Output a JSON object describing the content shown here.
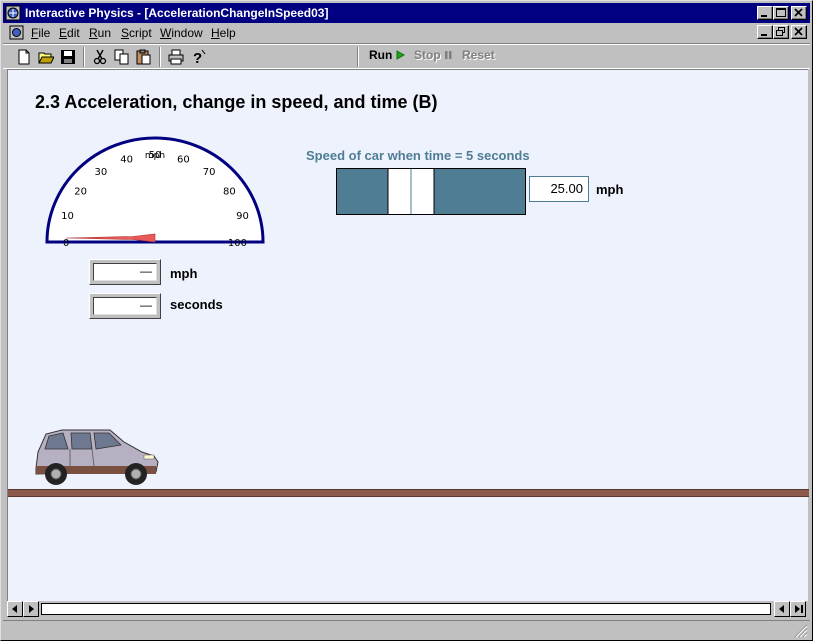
{
  "window": {
    "title": "Interactive Physics - [AccelerationChangeInSpeed03]"
  },
  "menu": {
    "items": [
      {
        "label": "File",
        "key": "F",
        "rest": "ile"
      },
      {
        "label": "Edit",
        "key": "E",
        "rest": "dit"
      },
      {
        "label": "Run",
        "key": "R",
        "rest": "un"
      },
      {
        "label": "Script",
        "key": "S",
        "rest": "cript"
      },
      {
        "label": "Window",
        "key": "W",
        "rest": "indow"
      },
      {
        "label": "Help",
        "key": "H",
        "rest": "elp"
      }
    ]
  },
  "toolbar": {
    "buttons": [
      "new-icon",
      "open-icon",
      "save-icon",
      "cut-icon",
      "copy-icon",
      "paste-icon",
      "print-icon",
      "help-icon"
    ],
    "run_label": "Run",
    "stop_label": "Stop",
    "reset_label": "Reset"
  },
  "doc": {
    "title": "2.3 Acceleration, change in speed, and time (B)",
    "speedometer": {
      "unit": "mph",
      "ticks": [
        "0",
        "10",
        "20",
        "30",
        "40",
        "50",
        "60",
        "70",
        "80",
        "90",
        "100"
      ],
      "needle_value": 0
    },
    "speed_readout": {
      "value": "—",
      "unit": "mph"
    },
    "time_readout": {
      "value": "—",
      "unit": "seconds"
    },
    "slider": {
      "caption": "Speed of car when time = 5 seconds",
      "value": "25.00",
      "unit": "mph",
      "min": 0,
      "max": 100,
      "fraction": 0.36
    }
  },
  "colors": {
    "titlebar": "#000080",
    "doc_background": "#eef2fd",
    "slider": "#4e7d94",
    "gauge_border": "#000080",
    "needle": "#e85a5a",
    "ground": "#8b5a4c"
  }
}
